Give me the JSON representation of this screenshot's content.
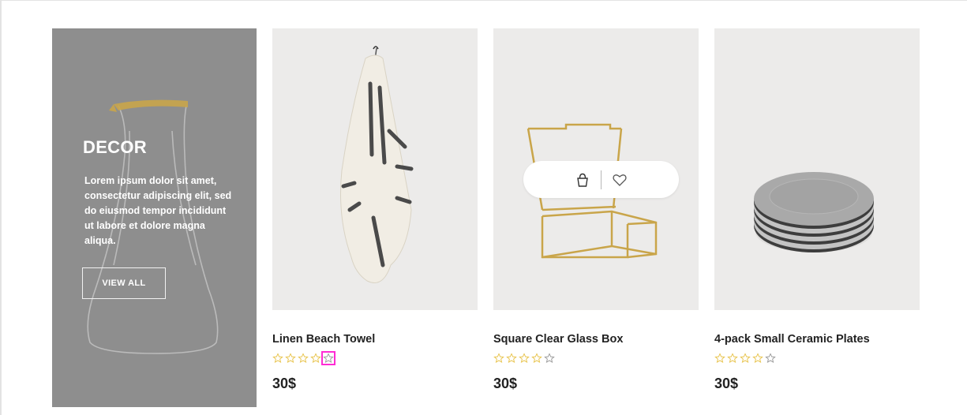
{
  "promo": {
    "title": "DECOR",
    "text": "Lorem ipsum dolor sit amet, consectetur adipiscing elit, sed do eiusmod tempor incididunt ut labore et dolore magna aliqua.",
    "button_label": "VIEW ALL"
  },
  "products": [
    {
      "name": "Linen Beach Towel",
      "rating": 0,
      "max_rating": 5,
      "price": "30$"
    },
    {
      "name": "Square Clear Glass Box",
      "rating": 0,
      "max_rating": 5,
      "price": "30$"
    },
    {
      "name": "4-pack Small Ceramic Plates",
      "rating": 0,
      "max_rating": 5,
      "price": "30$"
    }
  ],
  "colors": {
    "promo_bg": "#8e8e8e",
    "card_bg": "#ecebea",
    "star_gold": "#e8c34a",
    "star_grey": "#9a9a9a",
    "highlight": "#ff2bd4"
  },
  "icons": {
    "quick_cart": "shopping-bag-icon",
    "quick_wishlist": "heart-icon"
  }
}
